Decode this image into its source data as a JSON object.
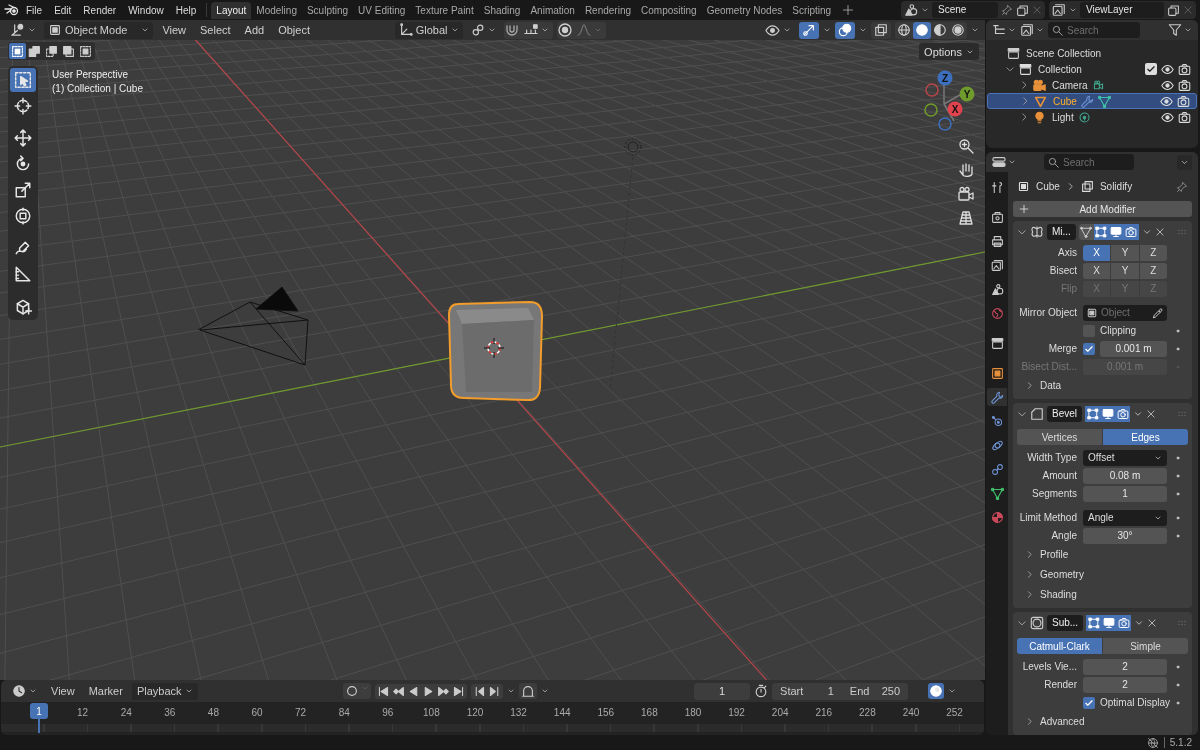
{
  "topbar": {
    "menus": [
      "File",
      "Edit",
      "Render",
      "Window",
      "Help"
    ],
    "workspaces": [
      {
        "label": "Layout",
        "selected": true
      },
      {
        "label": "Modeling",
        "selected": false
      },
      {
        "label": "Sculpting",
        "selected": false
      },
      {
        "label": "UV Editing",
        "selected": false
      },
      {
        "label": "Texture Paint",
        "selected": false
      },
      {
        "label": "Shading",
        "selected": false
      },
      {
        "label": "Animation",
        "selected": false
      },
      {
        "label": "Rendering",
        "selected": false
      },
      {
        "label": "Compositing",
        "selected": false
      },
      {
        "label": "Geometry Nodes",
        "selected": false
      },
      {
        "label": "Scripting",
        "selected": false
      }
    ],
    "scene": "Scene",
    "view_layer": "ViewLayer"
  },
  "viewport": {
    "header": {
      "mode": "Object Mode",
      "menus": [
        "View",
        "Select",
        "Add",
        "Object"
      ],
      "orientation": "Global",
      "gizmos_on": true,
      "overlays_on": true,
      "xray": false,
      "shading": [
        {
          "kind": "wireframe",
          "selected": false
        },
        {
          "kind": "solid",
          "selected": true
        },
        {
          "kind": "material",
          "selected": false
        },
        {
          "kind": "rendered",
          "selected": false
        }
      ]
    },
    "select_modes": [
      {
        "kind": "set",
        "selected": true
      },
      {
        "kind": "extend",
        "selected": false
      },
      {
        "kind": "subtract",
        "selected": false
      },
      {
        "kind": "invert",
        "selected": false
      },
      {
        "kind": "intersect",
        "selected": false
      }
    ],
    "options": "Options",
    "tools": [
      {
        "kind": "select",
        "selected": true
      },
      {
        "kind": "cursor",
        "selected": false
      },
      {
        "kind": "move",
        "selected": false
      },
      {
        "kind": "rotate",
        "selected": false
      },
      {
        "kind": "scale",
        "selected": false
      },
      {
        "kind": "transform",
        "selected": false
      },
      {
        "kind": "annotate",
        "selected": false
      },
      {
        "kind": "measure",
        "selected": false
      },
      {
        "kind": "add_cube",
        "selected": false
      }
    ],
    "info": [
      "User Perspective",
      "(1) Collection | Cube"
    ],
    "gizmo_axes": [
      "X",
      "Y",
      "Z"
    ]
  },
  "outliner": {
    "search_placeholder": "Search",
    "items": [
      {
        "kind": "scene_collection",
        "label": "Scene Collection",
        "children": [
          {
            "kind": "collection",
            "label": "Collection",
            "expanded": true,
            "checked": true,
            "children": [
              {
                "kind": "camera",
                "label": "Camera",
                "selected": false,
                "expanded": false
              },
              {
                "kind": "mesh",
                "label": "Cube",
                "selected": true,
                "expanded": false
              },
              {
                "kind": "light",
                "label": "Light",
                "selected": false,
                "expanded": false
              }
            ]
          }
        ]
      }
    ]
  },
  "properties": {
    "search_placeholder": "Search",
    "tabs": [
      {
        "kind": "tool",
        "selected": false
      },
      {
        "kind": "render",
        "selected": false
      },
      {
        "kind": "output",
        "selected": false
      },
      {
        "kind": "view_layer",
        "selected": false
      },
      {
        "kind": "scene",
        "selected": false
      },
      {
        "kind": "world",
        "selected": false
      },
      {
        "kind": "collection",
        "selected": false
      },
      {
        "kind": "object",
        "selected": false
      },
      {
        "kind": "modifiers",
        "selected": true
      },
      {
        "kind": "particles",
        "selected": false
      },
      {
        "kind": "physics",
        "selected": false
      },
      {
        "kind": "constraints",
        "selected": false
      },
      {
        "kind": "data",
        "selected": false
      },
      {
        "kind": "material",
        "selected": false
      }
    ],
    "breadcrumb": [
      "Cube",
      "Solidify"
    ],
    "add_modifier": "Add Modifier",
    "modifiers": [
      {
        "kind": "mirror",
        "name": "Mi...",
        "expanded": true,
        "toggles": [
          {
            "kind": "cage",
            "on": false
          },
          {
            "kind": "edit_mode",
            "on": true
          },
          {
            "kind": "viewport",
            "on": true
          },
          {
            "kind": "render",
            "on": true
          }
        ],
        "rows": [
          {
            "kind": "axes",
            "label": "Axis",
            "disabled": false,
            "buttons": [
              {
                "label": "X",
                "selected": true
              },
              {
                "label": "Y",
                "selected": false
              },
              {
                "label": "Z",
                "selected": false
              }
            ]
          },
          {
            "kind": "axes",
            "label": "Bisect",
            "disabled": false,
            "buttons": [
              {
                "label": "X",
                "selected": false
              },
              {
                "label": "Y",
                "selected": false
              },
              {
                "label": "Z",
                "selected": false
              }
            ]
          },
          {
            "kind": "axes",
            "label": "Flip",
            "disabled": true,
            "buttons": [
              {
                "label": "X",
                "selected": false
              },
              {
                "label": "Y",
                "selected": false
              },
              {
                "label": "Z",
                "selected": false
              }
            ]
          },
          {
            "kind": "object",
            "label": "Mirror Object",
            "placeholder": "Object"
          },
          {
            "kind": "check",
            "label": "Clipping",
            "checked": false
          },
          {
            "kind": "checkvalue",
            "label": "Merge",
            "checked": true,
            "value": "0.001 m"
          },
          {
            "kind": "value",
            "label": "Bisect Dist...",
            "value": "0.001 m",
            "disabled": true
          },
          {
            "kind": "panel",
            "label": "Data",
            "expanded": false
          }
        ]
      },
      {
        "kind": "bevel",
        "name": "Bevel",
        "expanded": true,
        "toggles": [
          {
            "kind": "edit_mode",
            "on": true
          },
          {
            "kind": "viewport",
            "on": true
          },
          {
            "kind": "render",
            "on": true
          }
        ],
        "rows": [
          {
            "kind": "segmented",
            "options": [
              {
                "label": "Vertices",
                "selected": false
              },
              {
                "label": "Edges",
                "selected": true
              }
            ]
          },
          {
            "kind": "dropdown",
            "label": "Width Type",
            "value": "Offset"
          },
          {
            "kind": "value",
            "label": "Amount",
            "value": "0.08 m",
            "disabled": false
          },
          {
            "kind": "value",
            "label": "Segments",
            "value": "1",
            "disabled": false
          },
          {
            "kind": "dropdown",
            "label": "Limit Method",
            "value": "Angle"
          },
          {
            "kind": "value",
            "label": "Angle",
            "value": "30°",
            "disabled": false
          },
          {
            "kind": "panel",
            "label": "Profile",
            "expanded": false
          },
          {
            "kind": "panel",
            "label": "Geometry",
            "expanded": false
          },
          {
            "kind": "panel",
            "label": "Shading",
            "expanded": false
          }
        ]
      },
      {
        "kind": "subsurf",
        "name": "Sub...",
        "expanded": true,
        "toggles": [
          {
            "kind": "edit_mode",
            "on": true
          },
          {
            "kind": "viewport",
            "on": true
          },
          {
            "kind": "render",
            "on": true
          }
        ],
        "rows": [
          {
            "kind": "segmented",
            "options": [
              {
                "label": "Catmull-Clark",
                "selected": true
              },
              {
                "label": "Simple",
                "selected": false
              }
            ]
          },
          {
            "kind": "value",
            "label": "Levels Vie...",
            "value": "2",
            "disabled": false
          },
          {
            "kind": "value",
            "label": "Render",
            "value": "2",
            "disabled": false
          },
          {
            "kind": "check",
            "label": "Optimal Display",
            "checked": true
          },
          {
            "kind": "panel",
            "label": "Advanced",
            "expanded": false
          }
        ]
      }
    ]
  },
  "timeline": {
    "menus": [
      "View",
      "Marker"
    ],
    "playback": "Playback",
    "current_frame": "1",
    "start_label": "Start",
    "start": "1",
    "end_label": "End",
    "end": "250",
    "playhead": "1",
    "ruler": [
      "12",
      "24",
      "36",
      "48",
      "60",
      "72",
      "84",
      "96",
      "108",
      "120",
      "132",
      "144",
      "156",
      "168",
      "180",
      "192",
      "204",
      "216",
      "228",
      "240",
      "252"
    ]
  },
  "status_bar": {
    "version": "5.1.2"
  }
}
